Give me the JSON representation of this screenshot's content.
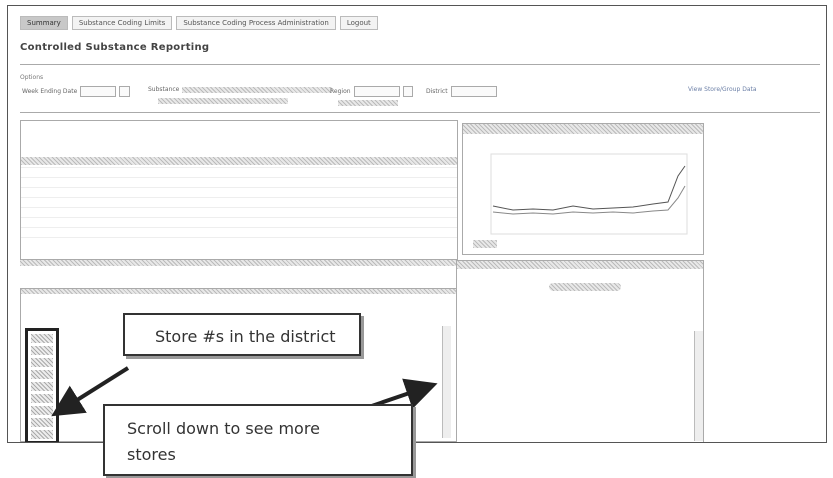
{
  "nav": {
    "tabs": [
      "Summary",
      "Substance Coding Limits",
      "Substance Coding Process Administration",
      "Logout"
    ]
  },
  "page": {
    "title": "Controlled Substance Reporting",
    "options_label": "Options",
    "week_ending_label": "Week Ending Date",
    "week_ending_value": "",
    "filter_label": "Substance",
    "filter_link": "Show Controlled Substance",
    "region_label": "Region",
    "district_label": "District",
    "view_label": "View Store/Group Data"
  },
  "callouts": {
    "stores_note": "Store #s in the district",
    "scroll_note_line1": "Scroll down to see more",
    "scroll_note_line2": "stores"
  },
  "colors": {
    "arrow": "#222222",
    "border": "#555555",
    "hatch": "#bbbbbb"
  }
}
